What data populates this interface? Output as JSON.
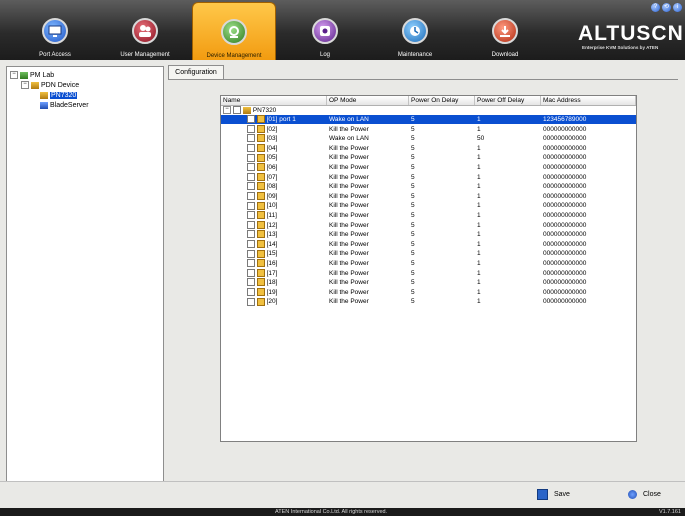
{
  "header": {
    "nav": [
      {
        "label": "Port Access",
        "icon": "monitor-icon"
      },
      {
        "label": "User Management",
        "icon": "users-icon"
      },
      {
        "label": "Device Management",
        "icon": "device-icon",
        "active": true
      },
      {
        "label": "Log",
        "icon": "log-icon"
      },
      {
        "label": "Maintenance",
        "icon": "maintenance-icon"
      },
      {
        "label": "Download",
        "icon": "download-icon"
      }
    ],
    "brand": "ALTUSCN",
    "tagline": "Enterprise KVM Solutions by ATEN",
    "window_buttons": [
      "?",
      "⟲",
      "i"
    ]
  },
  "tree": {
    "root": "PM Lab",
    "group": "PDN Device",
    "device": "PN7320",
    "other": "BladeServer"
  },
  "tab": "Configuration",
  "grid": {
    "columns": [
      "Name",
      "OP Mode",
      "Power On Delay",
      "Power Off Delay",
      "Mac Address"
    ],
    "group": "PN7320",
    "rows": [
      {
        "name": "[01] port 1",
        "mode": "Wake on LAN",
        "on": "5",
        "off": "1",
        "mac": "123456789000",
        "selected": true
      },
      {
        "name": "[02]",
        "mode": "Kill the Power",
        "on": "5",
        "off": "1",
        "mac": "000000000000"
      },
      {
        "name": "[03]",
        "mode": "Wake on LAN",
        "on": "5",
        "off": "50",
        "mac": "000000000000"
      },
      {
        "name": "[04]",
        "mode": "Kill the Power",
        "on": "5",
        "off": "1",
        "mac": "000000000000"
      },
      {
        "name": "[05]",
        "mode": "Kill the Power",
        "on": "5",
        "off": "1",
        "mac": "000000000000"
      },
      {
        "name": "[06]",
        "mode": "Kill the Power",
        "on": "5",
        "off": "1",
        "mac": "000000000000"
      },
      {
        "name": "[07]",
        "mode": "Kill the Power",
        "on": "5",
        "off": "1",
        "mac": "000000000000"
      },
      {
        "name": "[08]",
        "mode": "Kill the Power",
        "on": "5",
        "off": "1",
        "mac": "000000000000"
      },
      {
        "name": "[09]",
        "mode": "Kill the Power",
        "on": "5",
        "off": "1",
        "mac": "000000000000"
      },
      {
        "name": "[10]",
        "mode": "Kill the Power",
        "on": "5",
        "off": "1",
        "mac": "000000000000"
      },
      {
        "name": "[11]",
        "mode": "Kill the Power",
        "on": "5",
        "off": "1",
        "mac": "000000000000"
      },
      {
        "name": "[12]",
        "mode": "Kill the Power",
        "on": "5",
        "off": "1",
        "mac": "000000000000"
      },
      {
        "name": "[13]",
        "mode": "Kill the Power",
        "on": "5",
        "off": "1",
        "mac": "000000000000"
      },
      {
        "name": "[14]",
        "mode": "Kill the Power",
        "on": "5",
        "off": "1",
        "mac": "000000000000"
      },
      {
        "name": "[15]",
        "mode": "Kill the Power",
        "on": "5",
        "off": "1",
        "mac": "000000000000"
      },
      {
        "name": "[16]",
        "mode": "Kill the Power",
        "on": "5",
        "off": "1",
        "mac": "000000000000"
      },
      {
        "name": "[17]",
        "mode": "Kill the Power",
        "on": "5",
        "off": "1",
        "mac": "000000000000"
      },
      {
        "name": "[18]",
        "mode": "Kill the Power",
        "on": "5",
        "off": "1",
        "mac": "000000000000"
      },
      {
        "name": "[19]",
        "mode": "Kill the Power",
        "on": "5",
        "off": "1",
        "mac": "000000000000"
      },
      {
        "name": "[20]",
        "mode": "Kill the Power",
        "on": "5",
        "off": "1",
        "mac": "000000000000"
      }
    ]
  },
  "footer": {
    "save_label": "Save",
    "close_label": "Close"
  },
  "statusbar": {
    "copyright": "ATEN International Co.Ltd. All rights reserved.",
    "version": "V1.7.161"
  },
  "colors": {
    "accent": "#f29b10",
    "selection": "#0a4fd1",
    "header_bg": "#2b2b2b"
  }
}
